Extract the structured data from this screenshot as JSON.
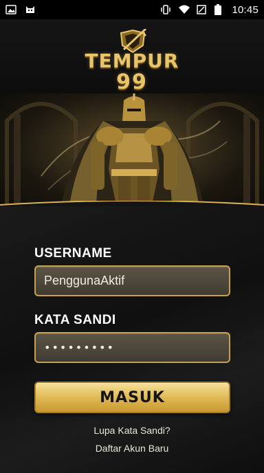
{
  "status_bar": {
    "time": "10:45",
    "left_icons": [
      "image-icon",
      "app-icon"
    ],
    "right_icons": [
      "vibrate-icon",
      "wifi-icon",
      "no-sim-icon",
      "battery-icon"
    ]
  },
  "logo": {
    "line1": "TEMPUR",
    "line2": "99"
  },
  "form": {
    "username_label": "USERNAME",
    "username_value": "PenggunaAktif",
    "password_label": "KATA SANDI",
    "password_masked": "•••••••••",
    "submit_label": "MASUK"
  },
  "links": {
    "forgot_password": "Lupa Kata Sandi?",
    "register": "Daftar Akun Baru"
  },
  "colors": {
    "accent_gold": "#e2bd5c",
    "field_border": "#c9a14e",
    "background": "#0d0d0d"
  }
}
